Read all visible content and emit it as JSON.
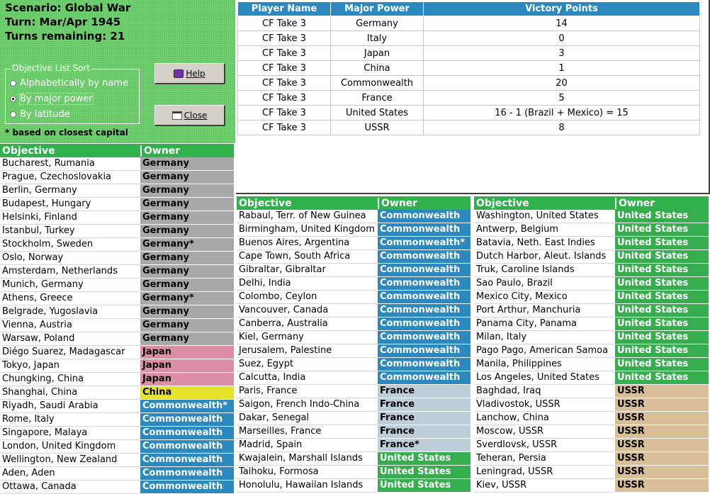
{
  "scenario": {
    "scenario_line": "Scenario: Global War",
    "turn_line": "Turn: Mar/Apr 1945",
    "remaining_line": "Turns remaining: 21"
  },
  "sort": {
    "title": "Objective List Sort",
    "options": [
      "Alphabetically by name",
      "By major power",
      "By latitude"
    ],
    "selected": 1
  },
  "buttons": {
    "help": "Help",
    "close": "Close"
  },
  "footnote": "* based on closest capital",
  "colors": {
    "panel_green": "#6fcf6f",
    "header_blue": "#2c89c0",
    "header_green": "#2fb24b",
    "Germany": "#a9a9a9",
    "Japan": "#dd8fa6",
    "China": "#e6e22c",
    "Commonwealth": "#2c89c0",
    "France": "#bccfd8",
    "United States": "#37ae4e",
    "USSR": "#d8bf98"
  },
  "vp_table": {
    "headers": [
      "Player Name",
      "Major Power",
      "Victory Points"
    ],
    "rows": [
      [
        "CF Take 3",
        "Germany",
        "14"
      ],
      [
        "CF Take 3",
        "Italy",
        "0"
      ],
      [
        "CF Take 3",
        "Japan",
        "3"
      ],
      [
        "CF Take 3",
        "China",
        "1"
      ],
      [
        "CF Take 3",
        "Commonwealth",
        "20"
      ],
      [
        "CF Take 3",
        "France",
        "5"
      ],
      [
        "CF Take 3",
        "United States",
        "16 - 1 (Brazil + Mexico) = 15"
      ],
      [
        "CF Take 3",
        "USSR",
        "8"
      ]
    ]
  },
  "objective_headers": {
    "objective": "Objective",
    "owner": "Owner"
  },
  "objective_lists": [
    [
      [
        "Bucharest, Rumania",
        "Germany",
        "Germany"
      ],
      [
        "Prague, Czechoslovakia",
        "Germany",
        "Germany"
      ],
      [
        "Berlin, Germany",
        "Germany",
        "Germany"
      ],
      [
        "Budapest, Hungary",
        "Germany",
        "Germany"
      ],
      [
        "Helsinki, Finland",
        "Germany",
        "Germany"
      ],
      [
        "Istanbul, Turkey",
        "Germany",
        "Germany"
      ],
      [
        "Stockholm, Sweden",
        "Germany*",
        "Germany"
      ],
      [
        "Oslo, Norway",
        "Germany",
        "Germany"
      ],
      [
        "Amsterdam, Netherlands",
        "Germany",
        "Germany"
      ],
      [
        "Munich, Germany",
        "Germany",
        "Germany"
      ],
      [
        "Athens, Greece",
        "Germany*",
        "Germany"
      ],
      [
        "Belgrade, Yugoslavia",
        "Germany",
        "Germany"
      ],
      [
        "Vienna, Austria",
        "Germany",
        "Germany"
      ],
      [
        "Warsaw, Poland",
        "Germany",
        "Germany"
      ],
      [
        "Diégo Suarez, Madagascar",
        "Japan",
        "Japan"
      ],
      [
        "Tokyo, Japan",
        "Japan",
        "Japan"
      ],
      [
        "Chungking, China",
        "Japan",
        "Japan"
      ],
      [
        "Shanghai, China",
        "China",
        "China"
      ],
      [
        "Riyadh, Saudi Arabia",
        "Commonwealth*",
        "Commonwealth"
      ],
      [
        "Rome, Italy",
        "Commonwealth",
        "Commonwealth"
      ],
      [
        "Singapore, Malaya",
        "Commonwealth",
        "Commonwealth"
      ],
      [
        "London, United Kingdom",
        "Commonwealth",
        "Commonwealth"
      ],
      [
        "Wellington, New Zealand",
        "Commonwealth",
        "Commonwealth"
      ],
      [
        "Aden, Aden",
        "Commonwealth",
        "Commonwealth"
      ],
      [
        "Ottawa, Canada",
        "Commonwealth",
        "Commonwealth"
      ]
    ],
    [
      [
        "Rabaul, Terr. of New Guinea",
        "Commonwealth",
        "Commonwealth"
      ],
      [
        "Birmingham, United Kingdom",
        "Commonwealth",
        "Commonwealth"
      ],
      [
        "Buenos Aires, Argentina",
        "Commonwealth*",
        "Commonwealth"
      ],
      [
        "Cape Town, South Africa",
        "Commonwealth",
        "Commonwealth"
      ],
      [
        "Gibraltar, Gibraltar",
        "Commonwealth",
        "Commonwealth"
      ],
      [
        "Delhi, India",
        "Commonwealth",
        "Commonwealth"
      ],
      [
        "Colombo, Ceylon",
        "Commonwealth",
        "Commonwealth"
      ],
      [
        "Vancouver, Canada",
        "Commonwealth",
        "Commonwealth"
      ],
      [
        "Canberra, Australia",
        "Commonwealth",
        "Commonwealth"
      ],
      [
        "Kiel, Germany",
        "Commonwealth",
        "Commonwealth"
      ],
      [
        "Jerusalem, Palestine",
        "Commonwealth",
        "Commonwealth"
      ],
      [
        "Suez, Egypt",
        "Commonwealth",
        "Commonwealth"
      ],
      [
        "Calcutta, India",
        "Commonwealth",
        "Commonwealth"
      ],
      [
        "Paris, France",
        "France",
        "France"
      ],
      [
        "Saigon, French Indo-China",
        "France",
        "France"
      ],
      [
        "Dakar, Senegal",
        "France",
        "France"
      ],
      [
        "Marseilles, France",
        "France",
        "France"
      ],
      [
        "Madrid, Spain",
        "France*",
        "France"
      ],
      [
        "Kwajalein, Marshall Islands",
        "United States",
        "United States"
      ],
      [
        "Taihoku, Formosa",
        "United States",
        "United States"
      ],
      [
        "Honolulu, Hawaiian Islands",
        "United States",
        "United States"
      ]
    ],
    [
      [
        "Washington, United States",
        "United States",
        "United States"
      ],
      [
        "Antwerp, Belgium",
        "United States",
        "United States"
      ],
      [
        "Batavia, Neth. East Indies",
        "United States",
        "United States"
      ],
      [
        "Dutch Harbor, Aleut. Islands",
        "United States",
        "United States"
      ],
      [
        "Truk, Caroline Islands",
        "United States",
        "United States"
      ],
      [
        "Sao Paulo, Brazil",
        "United States",
        "United States"
      ],
      [
        "Mexico City, Mexico",
        "United States",
        "United States"
      ],
      [
        "Port Arthur, Manchuria",
        "United States",
        "United States"
      ],
      [
        "Panama City, Panama",
        "United States",
        "United States"
      ],
      [
        "Milan, Italy",
        "United States",
        "United States"
      ],
      [
        "Pago Pago, American Samoa",
        "United States",
        "United States"
      ],
      [
        "Manila, Philippines",
        "United States",
        "United States"
      ],
      [
        "Los Angeles, United States",
        "United States",
        "United States"
      ],
      [
        "Baghdad, Iraq",
        "USSR",
        "USSR"
      ],
      [
        "Vladivostok, USSR",
        "USSR",
        "USSR"
      ],
      [
        "Lanchow, China",
        "USSR",
        "USSR"
      ],
      [
        "Moscow, USSR",
        "USSR",
        "USSR"
      ],
      [
        "Sverdlovsk, USSR",
        "USSR",
        "USSR"
      ],
      [
        "Teheran, Persia",
        "USSR",
        "USSR"
      ],
      [
        "Leningrad, USSR",
        "USSR",
        "USSR"
      ],
      [
        "Kiev, USSR",
        "USSR",
        "USSR"
      ]
    ]
  ]
}
